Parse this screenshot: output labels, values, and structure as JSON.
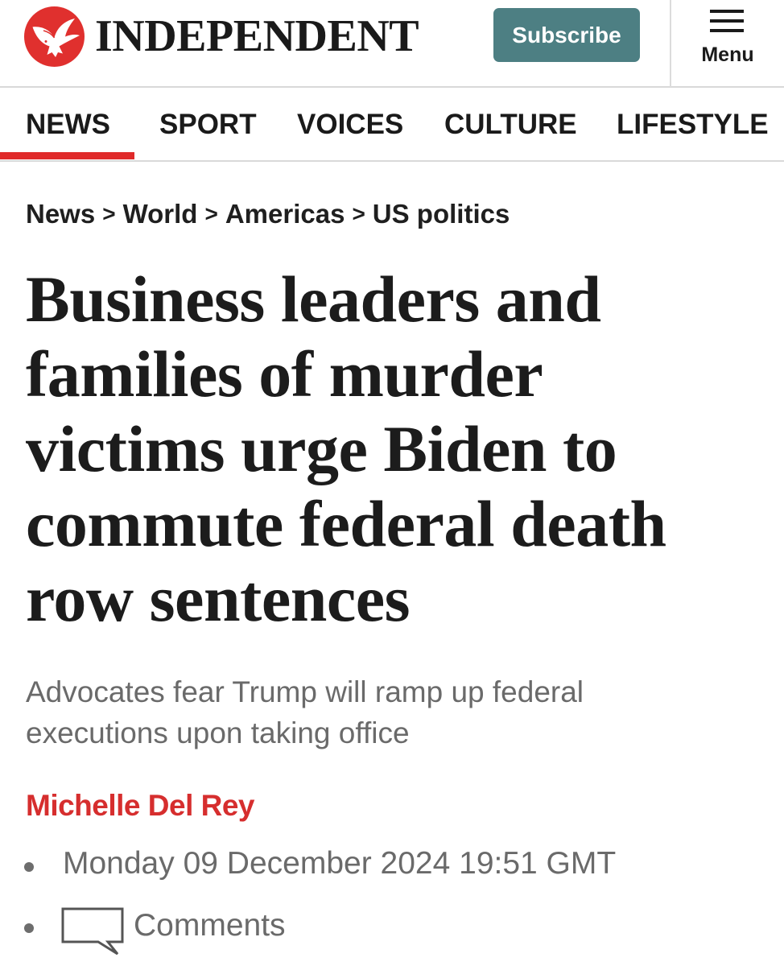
{
  "header": {
    "logo_text": "INDEPENDENT",
    "subscribe_label": "Subscribe",
    "menu_label": "Menu",
    "brand_red": "#e0302e",
    "subscribe_color": "#4d7f83"
  },
  "nav": {
    "items": [
      {
        "label": "NEWS",
        "active": true
      },
      {
        "label": "SPORT",
        "active": false
      },
      {
        "label": "VOICES",
        "active": false
      },
      {
        "label": "CULTURE",
        "active": false
      },
      {
        "label": "LIFESTYLE",
        "active": false
      }
    ],
    "active_color": "#e02a2a"
  },
  "breadcrumb": {
    "items": [
      "News",
      "World",
      "Americas",
      "US politics"
    ],
    "separator": ">"
  },
  "article": {
    "headline_lines": [
      "Business leaders and",
      "families of murder",
      "victims urge Biden to",
      "commute federal death",
      "row sentences"
    ],
    "standfirst_lines": [
      "Advocates fear Trump will ramp up federal",
      "executions upon taking office"
    ],
    "author": "Michelle Del Rey",
    "author_color": "#d62e2e",
    "published": "Monday 09 December 2024 19:51 GMT",
    "comments_label": "Comments",
    "icons": [
      "eagle-logo-icon",
      "hamburger-menu-icon",
      "bullet-icon",
      "comment-bubble-icon"
    ]
  }
}
